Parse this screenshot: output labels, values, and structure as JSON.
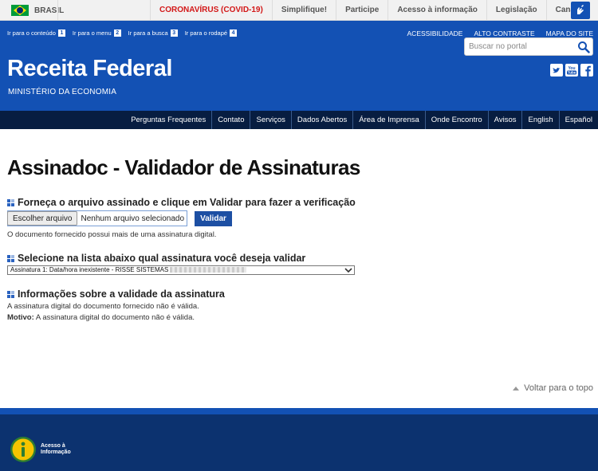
{
  "govbar": {
    "country": "BRASIL",
    "links": [
      "CORONAVÍRUS (COVID-19)",
      "Simplifique!",
      "Participe",
      "Acesso à informação",
      "Legislação",
      "Canais"
    ]
  },
  "header": {
    "skip_links": [
      {
        "label": "Ir para o conteúdo",
        "key": "1"
      },
      {
        "label": "Ir para o menu",
        "key": "2"
      },
      {
        "label": "Ir para a busca",
        "key": "3"
      },
      {
        "label": "Ir para o rodapé",
        "key": "4"
      }
    ],
    "top_links": [
      "ACESSIBILIDADE",
      "ALTO CONTRASTE",
      "MAPA DO SITE"
    ],
    "title": "Receita Federal",
    "subtitle": "MINISTÉRIO DA ECONOMIA",
    "search_placeholder": "Buscar no portal"
  },
  "nav": [
    "Perguntas Frequentes",
    "Contato",
    "Serviços",
    "Dados Abertos",
    "Área de Imprensa",
    "Onde Encontro",
    "Avisos",
    "English",
    "Español"
  ],
  "main": {
    "page_title": "Assinadoc - Validador de Assinaturas",
    "section1_title": "Forneça o arquivo assinado e clique em Validar para fazer a verificação",
    "file_button": "Escolher arquivo",
    "file_name": "Nenhum arquivo selecionado",
    "validate_button": "Validar",
    "section1_msg": "O documento fornecido possui mais de uma assinatura digital.",
    "section2_title": "Selecione na lista abaixo qual assinatura você deseja validar",
    "select_value": "Assinatura 1: Data/hora inexistente - RISSE SISTEMAS",
    "section3_title": "Informações sobre a validade da assinatura",
    "validity_msg": "A assinatura digital do documento fornecido não é válida.",
    "reason_label": "Motivo:",
    "reason_text": " A assinatura digital do documento não é válida.",
    "back_to_top": "Voltar para o topo"
  },
  "footer": {
    "info_label": "Acesso à Informação"
  },
  "colors": {
    "header_blue": "#1351b4",
    "nav_dark": "#071d41",
    "covid_red": "#d31717",
    "footer": "#0c326f"
  }
}
